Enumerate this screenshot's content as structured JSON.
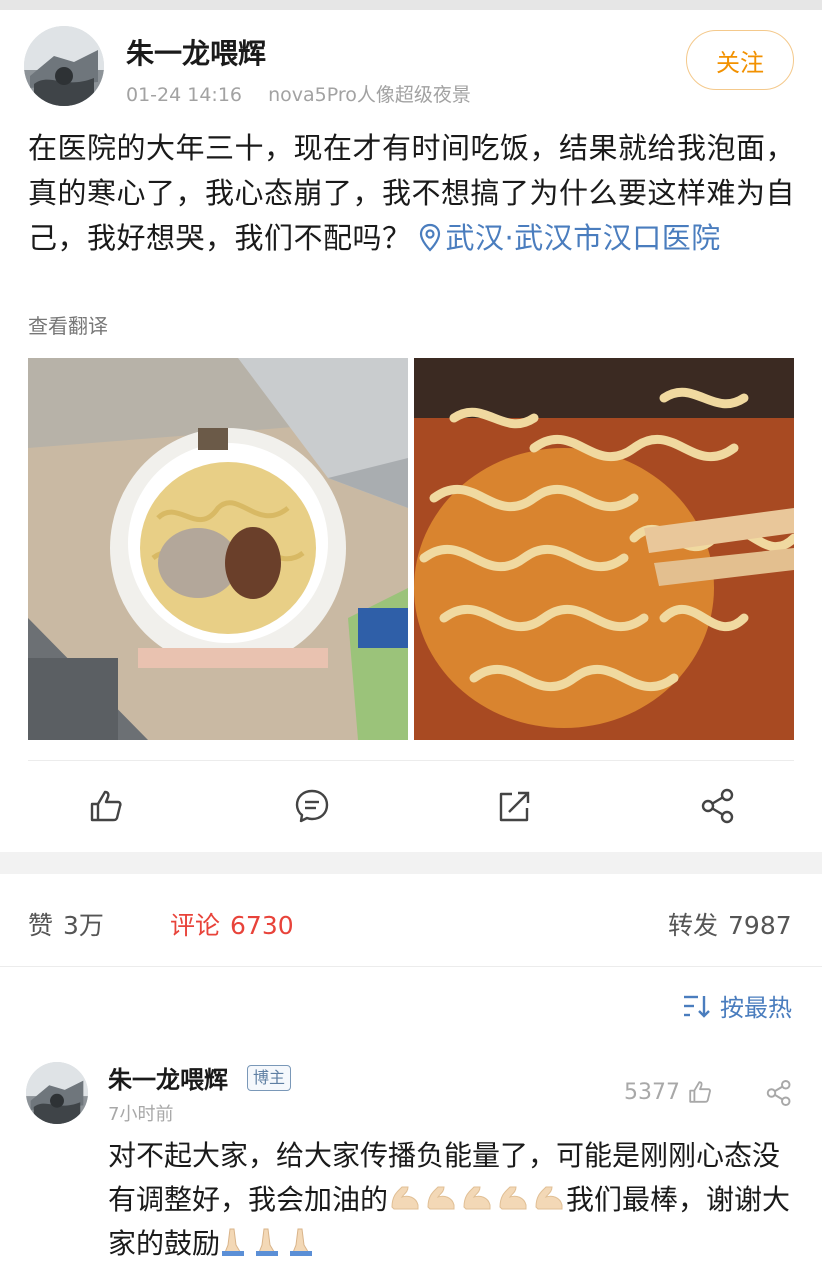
{
  "post": {
    "author": "朱一龙喂辉",
    "date": "01-24 14:16",
    "device": "nova5Pro人像超级夜景",
    "follow_label": "关注",
    "text": "在医院的大年三十，现在才有时间吃饭，结果就给我泡面，真的寒心了，我心态崩了，我不想搞了为什么要这样难为自己，我好想哭，我们不配吗？",
    "location": "武汉·武汉市汉口医院",
    "translate_label": "查看翻译"
  },
  "actions": {
    "icons": [
      "thumbs-up-icon",
      "comment-icon",
      "repost-icon",
      "share-icon"
    ]
  },
  "stats": {
    "like_label": "赞",
    "like_count": "3万",
    "comment_label": "评论",
    "comment_count": "6730",
    "repost_label": "转发",
    "repost_count": "7987"
  },
  "sort": {
    "label": "按最热"
  },
  "comment": {
    "author": "朱一龙喂辉",
    "badge": "博主",
    "time": "7小时前",
    "likes": "5377",
    "text_part1": "对不起大家，给大家传播负能量了，可能是刚刚心态没有调整好，我会加油的",
    "text_part2": "我们最棒，谢谢大家的鼓励"
  },
  "colors": {
    "link_blue": "#4a7dbe",
    "follow_orange": "#f29100",
    "comment_red": "#e8433a",
    "meta_gray": "#a2a2a2"
  }
}
